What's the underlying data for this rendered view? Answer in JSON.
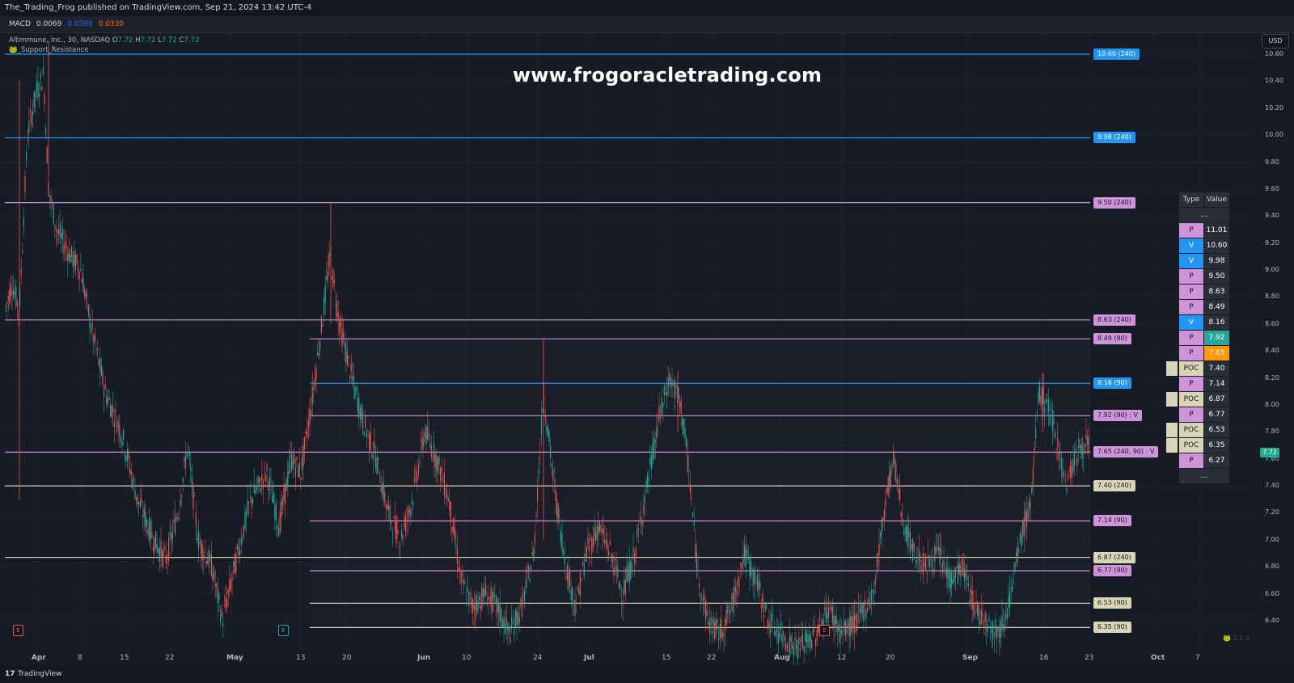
{
  "header": {
    "published": "The_Trading_Frog published on TradingView.com, Sep 21, 2024 13:42 UTC-4"
  },
  "macd": {
    "label": "MACD",
    "v1": "0.0069",
    "v2": "0.0398",
    "v3": "0.0330"
  },
  "legend": {
    "symbol": "Altimmune, Inc., 30, NASDAQ",
    "o_key": "O",
    "o": "7.72",
    "h_key": "H",
    "h": "7.72",
    "l_key": "L",
    "l": "7.72",
    "c_key": "C",
    "c": "7.72",
    "indicator": "🐸_Support_Resistance"
  },
  "watermark": "www.frogoracletrading.com",
  "currency": "USD",
  "last_price": "7.72",
  "colors": {
    "pivot": "#ce93d8",
    "valley": "#2196f3",
    "poc": "#d8d4b6",
    "up": "#26a69a",
    "down": "#ef5350",
    "bg": "#171b25"
  },
  "price_axis": [
    "10.60",
    "10.40",
    "10.20",
    "10.00",
    "9.80",
    "9.60",
    "9.40",
    "9.20",
    "9.00",
    "8.80",
    "8.60",
    "8.40",
    "8.20",
    "8.00",
    "7.80",
    "7.60",
    "7.40",
    "7.20",
    "7.00",
    "6.80",
    "6.60",
    "6.40"
  ],
  "date_axis": [
    "Apr",
    "8",
    "15",
    "22",
    "May",
    "13",
    "20",
    "Jun",
    "10",
    "24",
    "Jul",
    "15",
    "22",
    "Aug",
    "12",
    "20",
    "Sep",
    "16",
    "23",
    "Oct",
    "7"
  ],
  "levels": [
    {
      "price": 10.6,
      "label": "10.60 (240)",
      "kind": "valley",
      "start": "full"
    },
    {
      "price": 9.98,
      "label": "9.98 (240)",
      "kind": "valley",
      "start": "full"
    },
    {
      "price": 9.5,
      "label": "9.50 (240)",
      "kind": "pivot",
      "start": "full"
    },
    {
      "price": 8.63,
      "label": "8.63 (240)",
      "kind": "pivot",
      "start": "full"
    },
    {
      "price": 8.49,
      "label": "8.49 (90)",
      "kind": "pivot",
      "start": "mid"
    },
    {
      "price": 8.16,
      "label": "8.16 (90)",
      "kind": "valley",
      "start": "mid"
    },
    {
      "price": 7.92,
      "label": "7.92 (90)   : V",
      "kind": "pivot",
      "start": "mid"
    },
    {
      "price": 7.65,
      "label": "7.65 (240, 90)   : V",
      "kind": "pivot",
      "start": "full"
    },
    {
      "price": 7.4,
      "label": "7.40 (240)",
      "kind": "poc",
      "start": "full"
    },
    {
      "price": 7.14,
      "label": "7.14 (90)",
      "kind": "pivot",
      "start": "mid"
    },
    {
      "price": 6.87,
      "label": "6.87 (240)",
      "kind": "poc",
      "start": "full"
    },
    {
      "price": 6.77,
      "label": "6.77 (90)",
      "kind": "pivot",
      "start": "mid"
    },
    {
      "price": 6.53,
      "label": "6.53 (90)",
      "kind": "poc",
      "start": "mid"
    },
    {
      "price": 6.35,
      "label": "6.35 (90)",
      "kind": "poc",
      "start": "mid"
    }
  ],
  "table": {
    "header_type": "Type",
    "header_value": "Value",
    "ellipsis": "...",
    "rows": [
      {
        "type": "P",
        "value": "11.01",
        "kind": "pivot",
        "highlight": ""
      },
      {
        "type": "V",
        "value": "10.60",
        "kind": "valley",
        "highlight": ""
      },
      {
        "type": "V",
        "value": "9.98",
        "kind": "valley",
        "highlight": ""
      },
      {
        "type": "P",
        "value": "9.50",
        "kind": "pivot",
        "highlight": ""
      },
      {
        "type": "P",
        "value": "8.63",
        "kind": "pivot",
        "highlight": ""
      },
      {
        "type": "P",
        "value": "8.49",
        "kind": "pivot",
        "highlight": ""
      },
      {
        "type": "V",
        "value": "8.16",
        "kind": "valley",
        "highlight": ""
      },
      {
        "type": "P",
        "value": "7.92",
        "kind": "pivot",
        "highlight": "#26a69a"
      },
      {
        "type": "P",
        "value": "7.65",
        "kind": "pivot",
        "highlight": "#ff9800"
      },
      {
        "type": "POC",
        "value": "7.40",
        "kind": "poc",
        "highlight": ""
      },
      {
        "type": "P",
        "value": "7.14",
        "kind": "pivot",
        "highlight": ""
      },
      {
        "type": "POC",
        "value": "6.87",
        "kind": "poc",
        "highlight": ""
      },
      {
        "type": "P",
        "value": "6.77",
        "kind": "pivot",
        "highlight": ""
      },
      {
        "type": "POC",
        "value": "6.53",
        "kind": "poc",
        "highlight": ""
      },
      {
        "type": "POC",
        "value": "6.35",
        "kind": "poc",
        "highlight": ""
      },
      {
        "type": "P",
        "value": "6.27",
        "kind": "pivot",
        "highlight": ""
      }
    ]
  },
  "markers": [
    {
      "label": "E",
      "color": "#ef5350",
      "date": "Apr 1"
    },
    {
      "label": "E",
      "color": "#26a69a",
      "date": "May 9"
    },
    {
      "label": "E",
      "color": "#ef5350",
      "date": "Aug 8"
    }
  ],
  "frog_version": "🐸 2.1.3",
  "footer": {
    "brand": "TradingView"
  }
}
